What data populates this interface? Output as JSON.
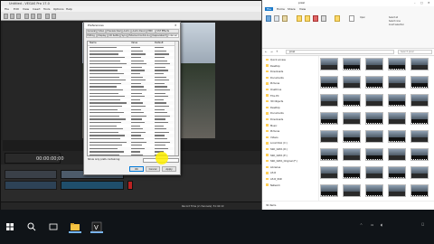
{
  "vegas": {
    "title": "Untitled - VEGAS Pro 17.0",
    "menu": [
      "File",
      "Edit",
      "View",
      "Insert",
      "Tools",
      "Options",
      "Help"
    ],
    "timecode": "00:00:00;00",
    "record_time": "Record Time (2 channels): 51:42:10"
  },
  "preferences": {
    "title": "Preferences",
    "tabs_row1": [
      "General",
      "Video",
      "Preview Device",
      "Audio",
      "Audio Device",
      "MIDI",
      "VST Effects"
    ],
    "tabs_row2": [
      "Editing",
      "Display",
      "CD Settings",
      "Sync",
      "External Control & Automation",
      "Deprecated Features",
      "Internal"
    ],
    "active_tab": "Internal",
    "columns": [
      "Name",
      "Value",
      "Default"
    ],
    "info_label": "Show only prefs containing:",
    "ok": "OK",
    "cancel": "Cancel",
    "apply": "Apply"
  },
  "explorer": {
    "title": "pixel",
    "tabs": [
      "File",
      "Home",
      "Share",
      "View"
    ],
    "ribbon_labels": [
      "Pin to Quick access",
      "Copy",
      "Paste",
      "Move to",
      "Copy to",
      "Delete",
      "Rename",
      "New folder",
      "Properties",
      "Open",
      "Select all",
      "Select none",
      "Invert selection"
    ],
    "address": "pixel",
    "search_placeholder": "Search pixel",
    "nav": [
      "Quick access",
      "Desktop",
      "Downloads",
      "Documents",
      "Pictures",
      "OneDrive",
      "This PC",
      "3D Objects",
      "Desktop",
      "Documents",
      "Downloads",
      "Music",
      "Pictures",
      "Videos",
      "Local Disk (C:)",
      "SSD_DATA (D:)",
      "SSD_DATA (E:)",
      "SSD_DATA_Original (F:)",
      "Libraries",
      "A3-R",
      "A3-R_SSD",
      "Network"
    ],
    "status": "30 items"
  },
  "colors": {
    "accent": "#0078d7",
    "highlight": "#fff000",
    "taskbar": "#101418"
  }
}
